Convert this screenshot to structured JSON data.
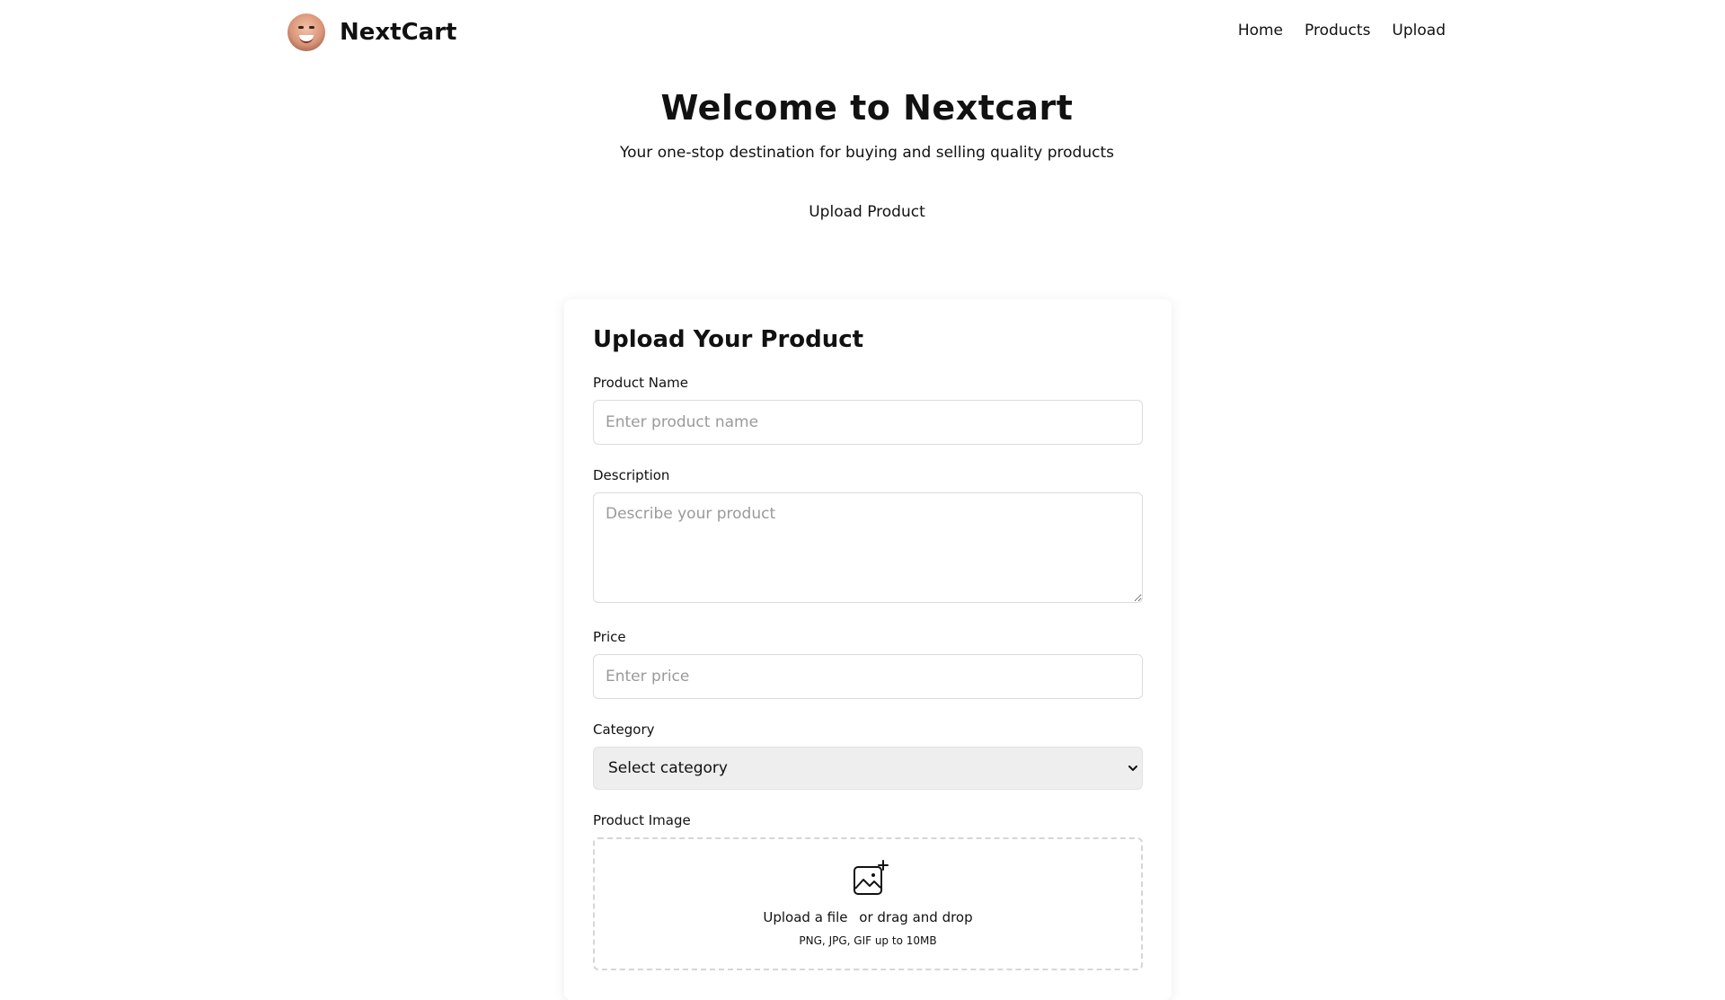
{
  "header": {
    "brand_name": "NextCart",
    "nav": [
      {
        "label": "Home"
      },
      {
        "label": "Products"
      },
      {
        "label": "Upload"
      }
    ]
  },
  "hero": {
    "title": "Welcome to Nextcart",
    "subtitle": "Your one-stop destination for buying and selling quality products",
    "upload_link": "Upload Product"
  },
  "form": {
    "title": "Upload Your Product",
    "product_name": {
      "label": "Product Name",
      "value": "",
      "placeholder": "Enter product name"
    },
    "description": {
      "label": "Description",
      "value": "",
      "placeholder": "Describe your product"
    },
    "price": {
      "label": "Price",
      "value": "",
      "placeholder": "Enter price"
    },
    "category": {
      "label": "Category",
      "selected": "Select category"
    },
    "image": {
      "label": "Product Image",
      "upload_link": "Upload a file",
      "drag_text": "or drag and drop",
      "hint": "PNG, JPG, GIF up to 10MB",
      "icon": "image-plus-icon"
    }
  },
  "icons": {
    "logo": "avatar-logo",
    "select": "chevron-down-icon"
  }
}
